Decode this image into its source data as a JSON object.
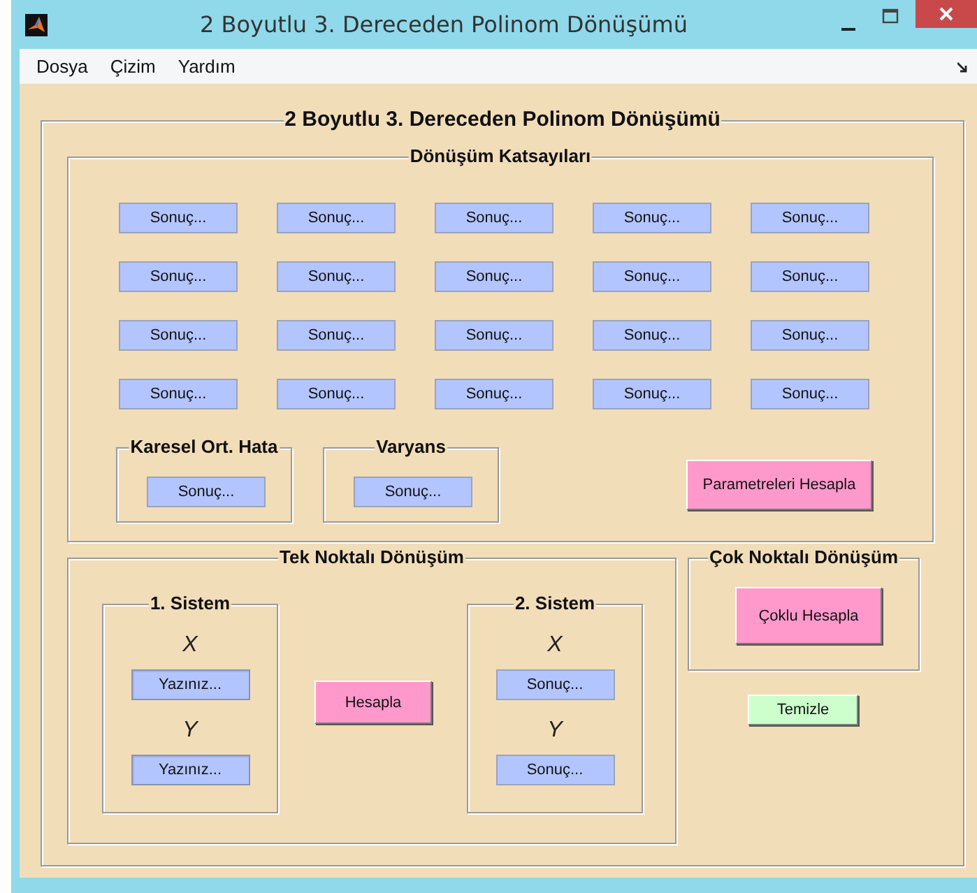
{
  "window": {
    "title": "2 Boyutlu 3. Dereceden Polinom Dönüşümü"
  },
  "menu": [
    "Dosya",
    "Çizim",
    "Yardım"
  ],
  "main_panel": {
    "title": "2 Boyutlu 3. Dereceden Polinom Dönüşümü",
    "coefficients_panel": {
      "title": "Dönüşüm Katsayıları",
      "results": [
        "Sonuç...",
        "Sonuç...",
        "Sonuç...",
        "Sonuç...",
        "Sonuç...",
        "Sonuç...",
        "Sonuç...",
        "Sonuç...",
        "Sonuç...",
        "Sonuç...",
        "Sonuç...",
        "Sonuç...",
        "Sonuç...",
        "Sonuç...",
        "Sonuç...",
        "Sonuç...",
        "Sonuç...",
        "Sonuç...",
        "Sonuç...",
        "Sonuç..."
      ],
      "error_panel": {
        "title": "Karesel Ort. Hata",
        "result": "Sonuç..."
      },
      "variance_panel": {
        "title": "Varyans",
        "result": "Sonuç..."
      },
      "compute_button": "Parametreleri Hesapla"
    },
    "single_point_panel": {
      "title": "Tek Noktalı Dönüşüm",
      "systems": [
        {
          "title": "1. Sistem",
          "fields": [
            {
              "label": "X",
              "kind": "input",
              "value": "Yazınız..."
            },
            {
              "label": "Y",
              "kind": "input",
              "value": "Yazınız..."
            }
          ]
        },
        {
          "title": "2. Sistem",
          "fields": [
            {
              "label": "X",
              "kind": "output",
              "value": "Sonuç..."
            },
            {
              "label": "Y",
              "kind": "output",
              "value": "Sonuç..."
            }
          ]
        }
      ],
      "compute_button": "Hesapla"
    },
    "multi_point_panel": {
      "title": "Çok Noktalı Dönüşüm",
      "compute_button": "Çoklu Hesapla"
    },
    "clear_button": "Temizle"
  }
}
